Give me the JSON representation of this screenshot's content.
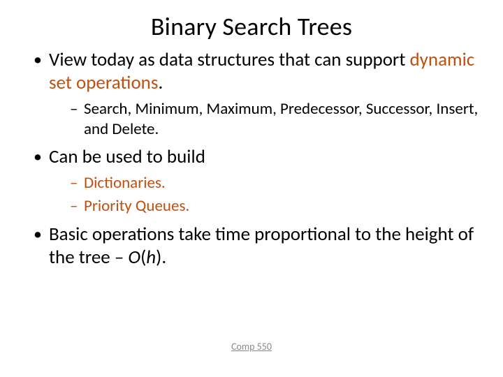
{
  "title": "Binary Search Trees",
  "bullets": {
    "b1_a": "View today as data structures that can support ",
    "b1_b": "dynamic set operations",
    "b1_c": ".",
    "b1_sub1": "Search, Minimum, Maximum, Predecessor, Successor, Insert, and Delete.",
    "b2": "Can be used to build",
    "b2_sub1": "Dictionaries.",
    "b2_sub2": "Priority Queues.",
    "b3_a": "Basic operations take time proportional to the height of the tree – ",
    "b3_b": "O",
    "b3_c": "(",
    "b3_d": "h",
    "b3_e": ")."
  },
  "footer": "Comp 550"
}
